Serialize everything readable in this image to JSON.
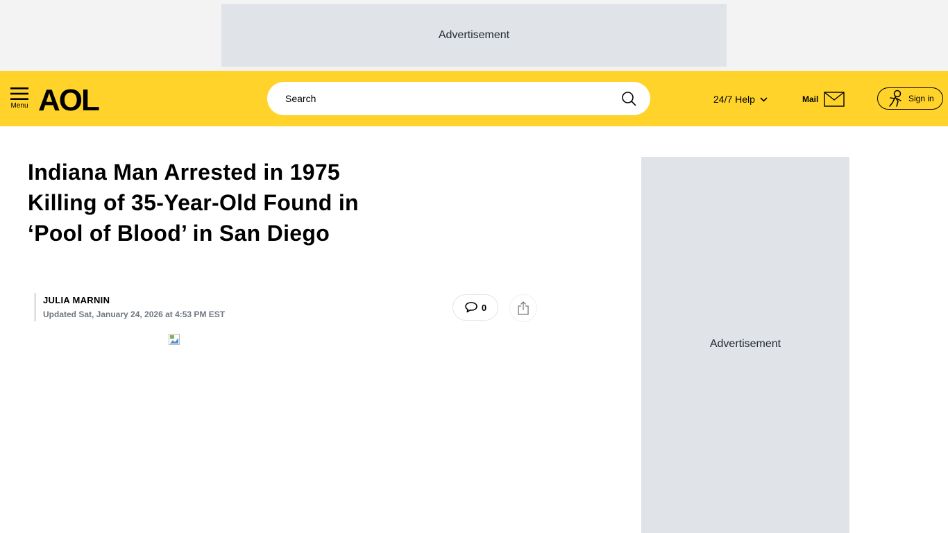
{
  "ads": {
    "top_label": "Advertisement",
    "side_label": "Advertisement"
  },
  "header": {
    "menu_label": "Menu",
    "logo_text": "AOL",
    "search_placeholder": "Search",
    "help_label": "24/7 Help",
    "mail_label": "Mail",
    "signin_label": "Sign in",
    "background_color": "#ffd32a"
  },
  "article": {
    "headline": "Indiana Man Arrested in 1975 Killing of 35-Year-Old Found in ‘Pool of Blood’ in San Diego",
    "author": "JULIA MARNIN",
    "updated": "Updated Sat, January 24, 2026 at 4:53 PM EST",
    "comment_count": "0"
  },
  "icons": {
    "menu": "hamburger-icon",
    "search": "search-icon",
    "help": "chevron-down-icon",
    "mail": "envelope-icon",
    "signin": "person-icon",
    "comments": "speech-bubble-icon",
    "share": "share-icon",
    "image": "broken-image-icon"
  }
}
